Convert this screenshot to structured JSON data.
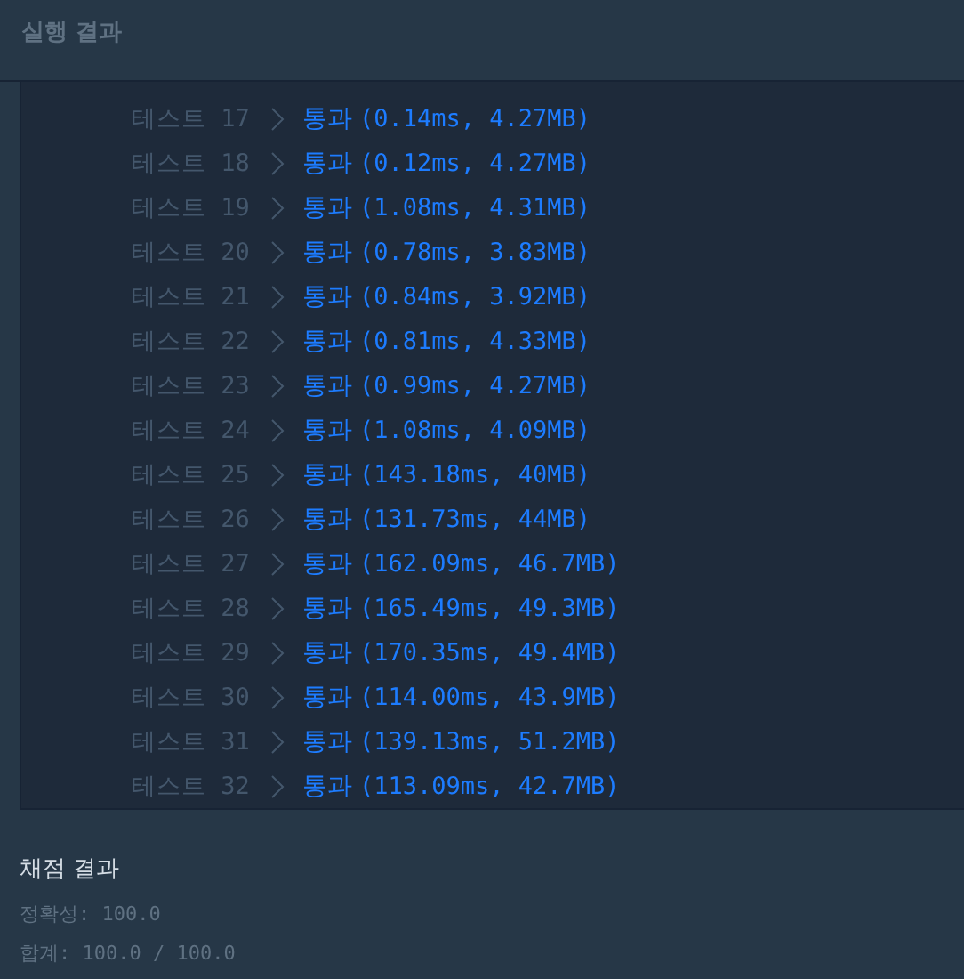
{
  "header": {
    "title": "실행 결과"
  },
  "tests": [
    {
      "label": "테스트 17",
      "status": "통과",
      "detail": "(0.14ms, 4.27MB)"
    },
    {
      "label": "테스트 18",
      "status": "통과",
      "detail": "(0.12ms, 4.27MB)"
    },
    {
      "label": "테스트 19",
      "status": "통과",
      "detail": "(1.08ms, 4.31MB)"
    },
    {
      "label": "테스트 20",
      "status": "통과",
      "detail": "(0.78ms, 3.83MB)"
    },
    {
      "label": "테스트 21",
      "status": "통과",
      "detail": "(0.84ms, 3.92MB)"
    },
    {
      "label": "테스트 22",
      "status": "통과",
      "detail": "(0.81ms, 4.33MB)"
    },
    {
      "label": "테스트 23",
      "status": "통과",
      "detail": "(0.99ms, 4.27MB)"
    },
    {
      "label": "테스트 24",
      "status": "통과",
      "detail": "(1.08ms, 4.09MB)"
    },
    {
      "label": "테스트 25",
      "status": "통과",
      "detail": "(143.18ms, 40MB)"
    },
    {
      "label": "테스트 26",
      "status": "통과",
      "detail": "(131.73ms, 44MB)"
    },
    {
      "label": "테스트 27",
      "status": "통과",
      "detail": "(162.09ms, 46.7MB)"
    },
    {
      "label": "테스트 28",
      "status": "통과",
      "detail": "(165.49ms, 49.3MB)"
    },
    {
      "label": "테스트 29",
      "status": "통과",
      "detail": "(170.35ms, 49.4MB)"
    },
    {
      "label": "테스트 30",
      "status": "통과",
      "detail": "(114.00ms, 43.9MB)"
    },
    {
      "label": "테스트 31",
      "status": "통과",
      "detail": "(139.13ms, 51.2MB)"
    },
    {
      "label": "테스트 32",
      "status": "통과",
      "detail": "(113.09ms, 42.7MB)"
    }
  ],
  "grading": {
    "title": "채점 결과",
    "accuracy": "정확성: 100.0",
    "total": "합계: 100.0 / 100.0"
  }
}
